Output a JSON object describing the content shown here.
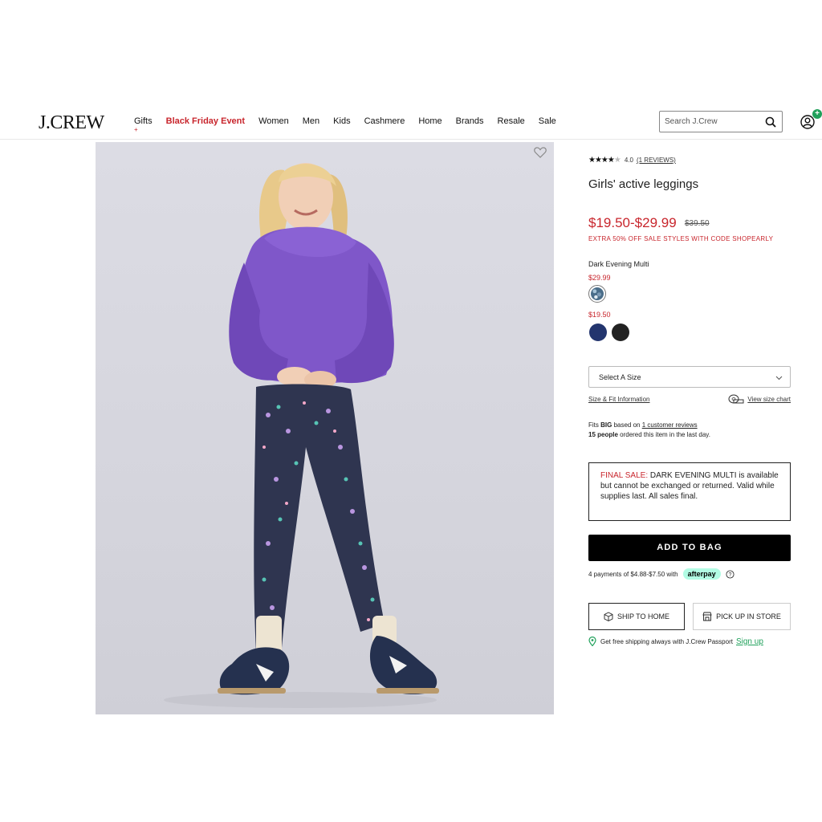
{
  "header": {
    "logo": "J.CREW",
    "nav": [
      "Gifts",
      "Black Friday Event",
      "Women",
      "Men",
      "Kids",
      "Cashmere",
      "Home",
      "Brands",
      "Resale",
      "Sale"
    ],
    "nav_dot": "+",
    "search_placeholder": "Search J.Crew",
    "account_badge": "+"
  },
  "product": {
    "rating_stars": "★★★★",
    "rating_star_empty": "★",
    "rating_value": "4.0",
    "reviews_link": "(1 REVIEWS)",
    "title": "Girls' active leggings",
    "price": "$19.50-$29.99",
    "old_price": "$39.50",
    "promo": "EXTRA 50% OFF SALE STYLES WITH CODE SHOPEARLY",
    "color_name": "Dark Evening Multi",
    "swatch_price_1": "$29.99",
    "swatch_price_2": "$19.50",
    "size_select": "Select A Size",
    "size_fit_link": "Size & Fit Information",
    "size_chart_link": "View size chart",
    "fits_prefix": "Fits ",
    "fits_big": "BIG",
    "fits_middle": " based on ",
    "fits_reviews_link": "1 customer reviews",
    "people_count": "15 people",
    "people_suffix": " ordered this item in the last day.",
    "final_sale_label": "FINAL SALE:",
    "final_sale_text": " DARK EVENING MULTI is available but cannot be exchanged or returned. Valid while supplies last. All sales final.",
    "add_to_bag": "ADD TO BAG",
    "afterpay_text": "4 payments of $4.88-$7.50 with",
    "afterpay_badge": "afterpay",
    "ship_home": "SHIP TO HOME",
    "pick_up": "PICK UP IN STORE",
    "passport_text": "Get free shipping always with J.Crew Passport",
    "sign_up": "Sign up"
  }
}
